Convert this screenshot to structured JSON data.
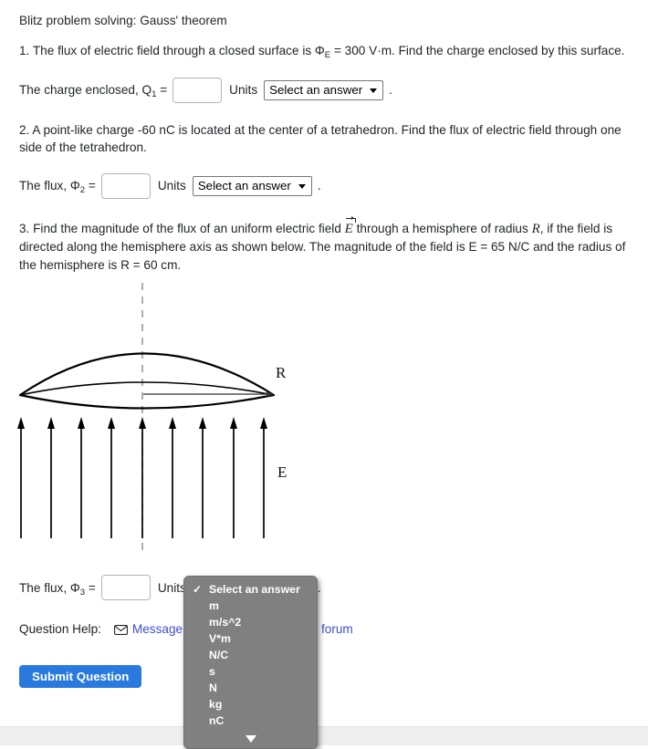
{
  "header": {
    "title": "Blitz problem solving: Gauss' theorem"
  },
  "questions": [
    {
      "number": "1.",
      "text_before": "The flux of electric field through a closed surface is ",
      "symbol": "Φ",
      "symbol_sub": "E",
      "text_mid": " = 300 V·m. Find the charge enclosed by this surface.",
      "answer": {
        "label_prefix": "The charge enclosed, Q",
        "label_sub": "1",
        "label_eq": " =",
        "input_value": "",
        "units_word": "Units",
        "select_value": "Select an answer",
        "trailing": "."
      }
    },
    {
      "number": "2.",
      "text": "A point-like charge -60 nC is located at the center of a tetrahedron. Find the flux of electric field through one side of the tetrahedron.",
      "answer": {
        "label_prefix": "The flux, Φ",
        "label_sub": "2",
        "label_eq": " =",
        "input_value": "",
        "units_word": "Units",
        "select_value": "Select an answer",
        "trailing": "."
      }
    },
    {
      "number": "3.",
      "text_a": "Find the magnitude of the flux of an uniform electric field ",
      "field_symbol": "E",
      "text_b": " through a hemisphere of radius ",
      "radius_symbol": "R",
      "text_c": ", if the field is directed along the hemisphere axis as shown below. The magnitude of the field is E = 65 N/C and the radius of the hemisphere is R = 60 cm.",
      "answer": {
        "label_prefix": "The flux, Φ",
        "label_sub": "3",
        "label_eq": " =",
        "input_value": "",
        "units_word": "Units",
        "select_value": "Select an answer",
        "trailing": "."
      }
    }
  ],
  "figure": {
    "radius_label": "R",
    "field_label": "E",
    "arrow_count": 9
  },
  "question_help": {
    "label": "Question Help:",
    "message_link": "Message",
    "forum_link": "forum"
  },
  "submit": {
    "label": "Submit Question"
  },
  "dropdown": {
    "open": true,
    "selected": "Select an answer",
    "check_glyph": "✓",
    "options": [
      "Select an answer",
      "m",
      "m/s^2",
      "V*m",
      "N/C",
      "s",
      "N",
      "kg",
      "nC"
    ],
    "more_indicator": "▼",
    "background_color": "#808080",
    "text_color": "#ffffff"
  },
  "colors": {
    "link": "#3b4fd0",
    "submit_button": "#2a7ade",
    "page_background": "#ffffff",
    "bottom_band": "#eeeeee"
  }
}
